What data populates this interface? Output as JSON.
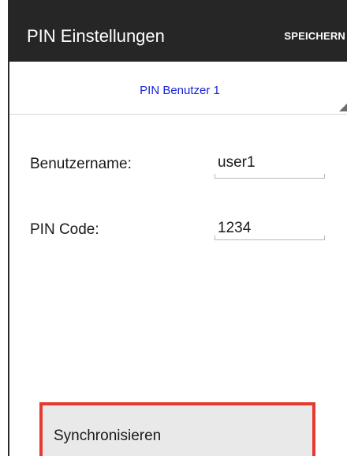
{
  "header": {
    "title": "PIN Einstellungen",
    "save_label": "SPEICHERN"
  },
  "user_selector": {
    "selected": "PIN Benutzer 1"
  },
  "form": {
    "username_label": "Benutzername:",
    "username_value": "user1",
    "pin_label": "PIN Code:",
    "pin_value": "1234"
  },
  "actions": {
    "sync_label": "Synchronisieren"
  },
  "colors": {
    "appbar": "#262626",
    "accent_text": "#1a23d6",
    "highlight_border": "#e53a2f"
  }
}
